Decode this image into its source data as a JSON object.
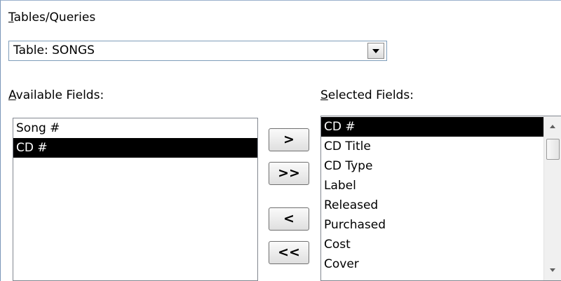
{
  "tables_queries": {
    "label_key": "T",
    "label_rest": "ables/Queries",
    "selected": "Table: SONGS"
  },
  "available": {
    "label_key": "A",
    "label_rest": "vailable Fields:",
    "items": [
      "Song #",
      "CD #"
    ],
    "selected_index": 1
  },
  "selected": {
    "label_key": "S",
    "label_rest": "elected Fields:",
    "items": [
      "CD #",
      "CD Title",
      "CD Type",
      "Label",
      "Released",
      "Purchased",
      "Cost",
      "Cover"
    ],
    "selected_index": 0
  },
  "buttons": {
    "add_one": ">",
    "add_all": ">>",
    "remove_one": "<",
    "remove_all": "<<"
  },
  "icons": {
    "dropdown": "chevron-down-icon",
    "scroll_up": "arrow-up-icon",
    "scroll_down": "arrow-down-icon"
  }
}
